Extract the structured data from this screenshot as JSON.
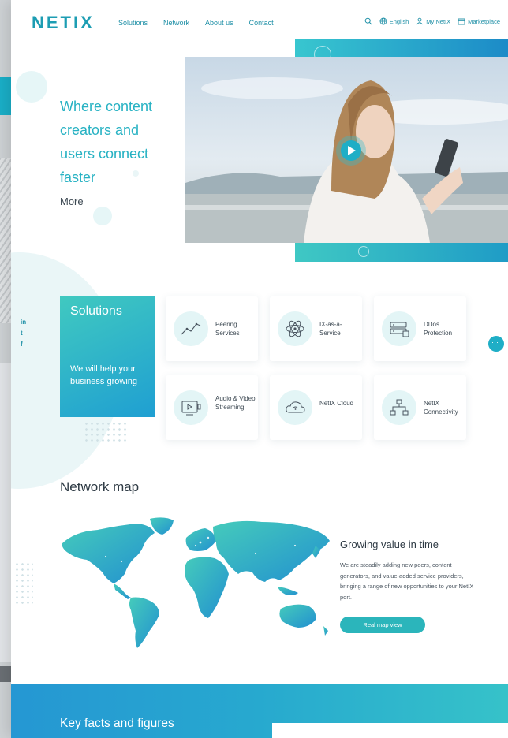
{
  "header": {
    "logo": "NETIX",
    "nav": [
      "Solutions",
      "Network",
      "About us",
      "Contact"
    ],
    "language": "English",
    "account": "My NetIX",
    "marketplace": "Marketplace"
  },
  "hero": {
    "title": "Where content creators and users connect faster",
    "more_link": "More"
  },
  "social": [
    "in",
    "t",
    "f"
  ],
  "solutions": {
    "title": "Solutions",
    "subtitle": "We will help your business growing",
    "cards": [
      {
        "label": "Peering Services",
        "icon": "peering-chart-icon"
      },
      {
        "label": "IX-as-a-Service",
        "icon": "atom-icon"
      },
      {
        "label": "DDos Protection",
        "icon": "server-shield-icon"
      },
      {
        "label": "Audio & Video Streaming",
        "icon": "video-screen-icon"
      },
      {
        "label": "NetIX Cloud",
        "icon": "cloud-icon"
      },
      {
        "label": "NetIX Connectivity",
        "icon": "network-nodes-icon"
      }
    ]
  },
  "chat_button": "···",
  "network": {
    "title": "Network map",
    "growing_title": "Growing value in time",
    "growing_text": "We are steadily adding new peers, content generators, and value-added service providers, bringing a range of new opportunities to your NetIX port.",
    "map_button": "Real map view"
  },
  "facts": {
    "title": "Key facts and figures"
  },
  "colors": {
    "accent": "#1d9db3",
    "teal": "#40c9c0",
    "blue": "#1f9fd2"
  }
}
